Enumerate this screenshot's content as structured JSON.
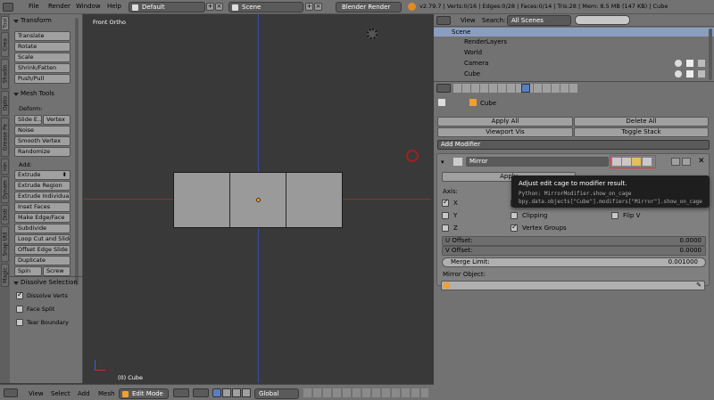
{
  "topbar": {
    "menus": [
      "File",
      "Render",
      "Window",
      "Help"
    ],
    "screen_layout": "Default",
    "scene": "Scene",
    "render_engine": "Blender Render",
    "stats": "v2.79.7 | Verts:0/16 | Edges:0/28 | Faces:0/14 | Tris:28 | Mem: 8.5 MB (147 KB) | Cube"
  },
  "side_tabs": [
    "Tool",
    "Crea",
    "Shadin",
    "Optio",
    "Grease Pe",
    "Hin",
    "Dynam",
    "Disti",
    "Snap Util",
    "Magic"
  ],
  "toolshelf": {
    "transform_header": "Transform",
    "transform_buttons": [
      "Translate",
      "Rotate",
      "Scale",
      "Shrink/Fatten",
      "Push/Pull"
    ],
    "mesh_tools_header": "Mesh Tools",
    "deform_label": "Deform:",
    "slide_edge": "Slide E...",
    "vertex": "Vertex",
    "noise": "Noise",
    "smooth_vertex": "Smooth Vertex",
    "randomize": "Randomize",
    "add_label": "Add:",
    "extrude": "Extrude",
    "add_buttons": [
      "Extrude Region",
      "Extrude Individual",
      "Inset Faces",
      "Make Edge/Face",
      "Subdivide",
      "Loop Cut and Slide",
      "Offset Edge Slide",
      "Duplicate"
    ],
    "spin": "Spin",
    "screw": "Screw",
    "dissolve_header": "Dissolve Selection",
    "dissolve_verts": "Dissolve Verts",
    "face_split": "Face Split",
    "tear_boundary": "Tear Boundary"
  },
  "viewport": {
    "view_label": "Front Ortho",
    "object_label": "(0) Cube"
  },
  "bottombar": {
    "menus": [
      "View",
      "Select",
      "Add",
      "Mesh"
    ],
    "mode": "Edit Mode",
    "orientation": "Global"
  },
  "outliner": {
    "menus": [
      "View",
      "Search:"
    ],
    "filter": "All Scenes",
    "items": [
      "Scene",
      "RenderLayers",
      "World",
      "Camera",
      "Cube"
    ]
  },
  "properties": {
    "object_name": "Cube",
    "apply_all": "Apply All",
    "delete_all": "Delete All",
    "viewport_vis": "Viewport Vis",
    "toggle_stack": "Toggle Stack",
    "add_modifier": "Add Modifier",
    "modifier_name": "Mirror",
    "apply": "Apply",
    "axis_label": "Axis:",
    "axes": [
      "X",
      "Y",
      "Z"
    ],
    "clipping": "Clipping",
    "vertex_groups": "Vertex Groups",
    "flip_v": "Flip V",
    "u_offset_label": "U Offset:",
    "u_offset_value": "0.0000",
    "v_offset_label": "V Offset:",
    "v_offset_value": "0.0000",
    "merge_limit_label": "Merge Limit:",
    "merge_limit_value": "0.001000",
    "mirror_object_label": "Mirror Object:"
  },
  "tooltip": {
    "title": "Adjust edit cage to modifier result.",
    "python": "Python: MirrorModifier.show_on_cage",
    "path": "bpy.data.objects[\"Cube\"].modifiers[\"Mirror\"].show_on_cage"
  },
  "colors": {
    "highlight": "#e03a3a",
    "active_blue": "#5680c2",
    "selected_tab": "#8a9ec0"
  }
}
